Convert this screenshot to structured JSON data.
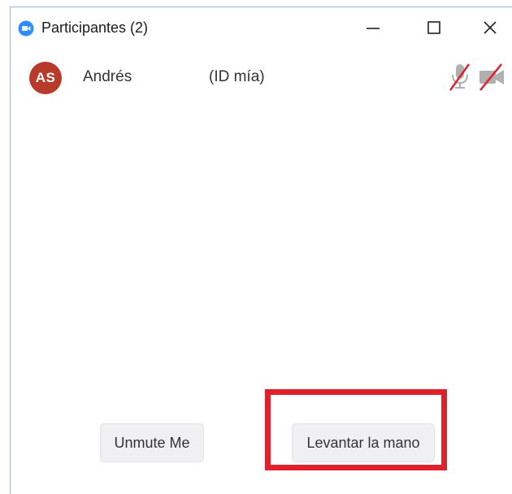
{
  "window": {
    "title": "Participantes (2)",
    "icons": {
      "app": "zoom-app-icon",
      "minimize": "minimize-icon",
      "maximize": "maximize-icon",
      "close": "close-icon"
    }
  },
  "participants": [
    {
      "initials": "AS",
      "name": "Andrés",
      "tag": "(ID mía)",
      "avatar_color": "#b83a2b",
      "mic_status": "muted",
      "video_status": "off"
    }
  ],
  "footer": {
    "unmute_label": "Unmute Me",
    "raise_hand_label": "Levantar la mano"
  },
  "colors": {
    "accent": "#2d8cff",
    "status_off": "#e0202a",
    "highlight": "#e0202a"
  }
}
